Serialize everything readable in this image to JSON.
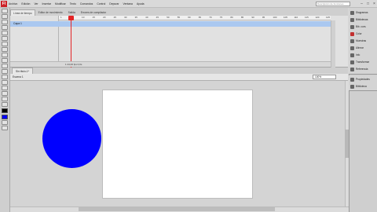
{
  "app": {
    "logo": "Fl"
  },
  "menu": [
    "Archivo",
    "Edición",
    "Ver",
    "Insertar",
    "Modificar",
    "Texto",
    "Comandos",
    "Control",
    "Depurar",
    "Ventana",
    "Ayuda"
  ],
  "search": {
    "placeholder": "Descripción de funciones"
  },
  "timeline": {
    "tabs": [
      "Línea de tiempo",
      "Editor de movimiento",
      "Salida",
      "Errores de compilador"
    ],
    "frames": [
      "1",
      "5",
      "10",
      "15",
      "20",
      "25",
      "30",
      "35",
      "40",
      "45",
      "50",
      "55",
      "60",
      "65",
      "70",
      "75",
      "80",
      "85",
      "90",
      "95",
      "100",
      "105",
      "110",
      "115",
      "120",
      "125"
    ],
    "layer": "Capa 1",
    "footer": "1  24,00 fps  0,0s"
  },
  "document": {
    "tab": "Sin título-1*",
    "scene": "Escena 1",
    "zoom": "100%"
  },
  "colors": {
    "stage_bg": "#ffffff",
    "circle_fill": "#0000ff",
    "layer_highlight": "#aac8f0",
    "playhead": "#e32526",
    "stroke_swatch": "#000000",
    "fill_swatch": "#0000ff"
  },
  "panels": {
    "top": [
      "Diagramas",
      "Bibliotecas",
      "Bib. com.",
      "Color",
      "Muestras",
      "Alinear",
      "Info",
      "Transformar",
      "Referencia"
    ],
    "bottom": [
      "Propiedades",
      "Biblioteca"
    ]
  }
}
